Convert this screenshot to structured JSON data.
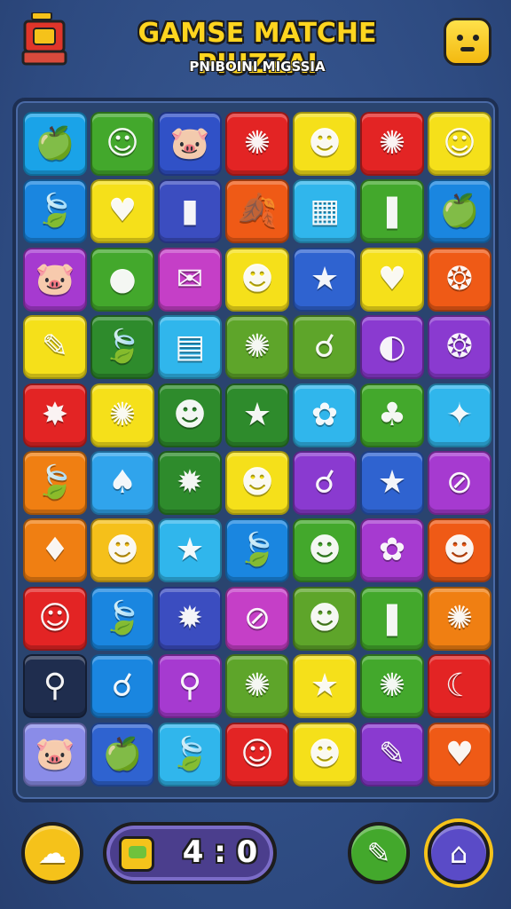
{
  "header": {
    "title": "GAMSE MATCHE PIUZZAI",
    "subtitle": "PNIBOINI MIGSSIA",
    "shop_icon": "shop-chest-icon",
    "mascot_icon": "smiley-mascot-icon"
  },
  "board": {
    "columns": 7,
    "rows": 10,
    "tiles": [
      [
        {
          "color": "#1aa3e8",
          "icon": "🍏"
        },
        {
          "color": "#43a82c",
          "icon": "☺"
        },
        {
          "color": "#3051c7",
          "icon": "🐷"
        },
        {
          "color": "#e32424",
          "icon": "✺"
        },
        {
          "color": "#f5e01a",
          "icon": "☻"
        },
        {
          "color": "#e32424",
          "icon": "✺"
        },
        {
          "color": "#f5e01a",
          "icon": "☺"
        }
      ],
      [
        {
          "color": "#1a86e0",
          "icon": "🍃"
        },
        {
          "color": "#f5e01a",
          "icon": "♥"
        },
        {
          "color": "#3b4dc0",
          "icon": "▮"
        },
        {
          "color": "#ef5a16",
          "icon": "🍂"
        },
        {
          "color": "#30b6ec",
          "icon": "▦"
        },
        {
          "color": "#43a82c",
          "icon": "❚"
        },
        {
          "color": "#1a86e0",
          "icon": "🍏"
        }
      ],
      [
        {
          "color": "#a63ad0",
          "icon": "🐷"
        },
        {
          "color": "#43a82c",
          "icon": "●"
        },
        {
          "color": "#c53fc7",
          "icon": "✉"
        },
        {
          "color": "#f5e01a",
          "icon": "☻"
        },
        {
          "color": "#2f63d0",
          "icon": "★"
        },
        {
          "color": "#f5e01a",
          "icon": "♥"
        },
        {
          "color": "#ef5a16",
          "icon": "❂"
        }
      ],
      [
        {
          "color": "#f5e01a",
          "icon": "✎"
        },
        {
          "color": "#2e8b2c",
          "icon": "🍃"
        },
        {
          "color": "#30b6ec",
          "icon": "▤"
        },
        {
          "color": "#5ea52a",
          "icon": "✺"
        },
        {
          "color": "#5ea52a",
          "icon": "☌"
        },
        {
          "color": "#8a3ad0",
          "icon": "◐"
        },
        {
          "color": "#8a3ad0",
          "icon": "❂"
        }
      ],
      [
        {
          "color": "#e32424",
          "icon": "✸"
        },
        {
          "color": "#f5e01a",
          "icon": "✺"
        },
        {
          "color": "#2e8b2c",
          "icon": "☻"
        },
        {
          "color": "#2e8b2c",
          "icon": "★"
        },
        {
          "color": "#30b6ec",
          "icon": "✿"
        },
        {
          "color": "#43a82c",
          "icon": "♣"
        },
        {
          "color": "#30b6ec",
          "icon": "✦"
        }
      ],
      [
        {
          "color": "#f07f12",
          "icon": "🍃"
        },
        {
          "color": "#30a4ec",
          "icon": "♠"
        },
        {
          "color": "#2e8b2c",
          "icon": "✹"
        },
        {
          "color": "#f5e01a",
          "icon": "☻"
        },
        {
          "color": "#8a3ad0",
          "icon": "☌"
        },
        {
          "color": "#2f63d0",
          "icon": "★"
        },
        {
          "color": "#a63ad0",
          "icon": "⊘"
        }
      ],
      [
        {
          "color": "#f07f12",
          "icon": "♦"
        },
        {
          "color": "#f5c01a",
          "icon": "☻"
        },
        {
          "color": "#30b6ec",
          "icon": "★"
        },
        {
          "color": "#1a86e0",
          "icon": "🍃"
        },
        {
          "color": "#43a82c",
          "icon": "☻"
        },
        {
          "color": "#a63ad0",
          "icon": "✿"
        },
        {
          "color": "#ef5a16",
          "icon": "☻"
        }
      ],
      [
        {
          "color": "#e32424",
          "icon": "☺"
        },
        {
          "color": "#1a86e0",
          "icon": "🍃"
        },
        {
          "color": "#3b4dc0",
          "icon": "✹"
        },
        {
          "color": "#c53fc7",
          "icon": "⊘"
        },
        {
          "color": "#5ea52a",
          "icon": "☻"
        },
        {
          "color": "#43a82c",
          "icon": "❚"
        },
        {
          "color": "#f07f12",
          "icon": "✺"
        }
      ],
      [
        {
          "color": "#1f2d4e",
          "icon": "⚲"
        },
        {
          "color": "#1a86e0",
          "icon": "☌"
        },
        {
          "color": "#a63ad0",
          "icon": "⚲"
        },
        {
          "color": "#5ea52a",
          "icon": "✺"
        },
        {
          "color": "#f5e01a",
          "icon": "★"
        },
        {
          "color": "#43a82c",
          "icon": "✺"
        },
        {
          "color": "#e32424",
          "icon": "☾"
        }
      ],
      [
        {
          "color": "#8a8ce8",
          "icon": "🐷"
        },
        {
          "color": "#2f63d0",
          "icon": "🍏"
        },
        {
          "color": "#30b6ec",
          "icon": "🍃"
        },
        {
          "color": "#e32424",
          "icon": "☺"
        },
        {
          "color": "#f5e01a",
          "icon": "☻"
        },
        {
          "color": "#8a3ad0",
          "icon": "✎"
        },
        {
          "color": "#ef5a16",
          "icon": "♥"
        }
      ]
    ]
  },
  "bottom_bar": {
    "score": "4 : 0",
    "left_button_icon": "ghost-hint-icon",
    "score_icon": "treasure-chest-icon",
    "shuffle_button_icon": "pencil-tool-icon",
    "menu_button_icon": "home-menu-icon",
    "colors": {
      "left_button": "#f5c21a",
      "shuffle_button": "#43a82c",
      "menu_button": "#5a4bc7",
      "menu_ring": "#f5c21a"
    }
  }
}
